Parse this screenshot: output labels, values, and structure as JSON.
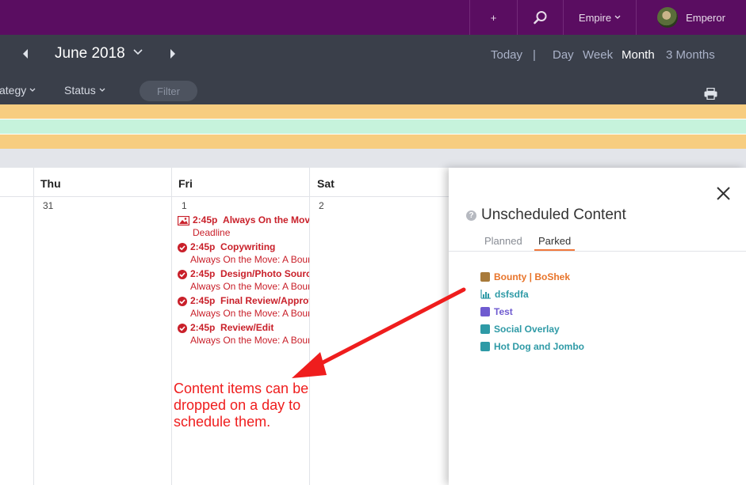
{
  "topbar": {
    "add_icon": "plus-icon",
    "search_icon": "search-icon",
    "workspace_label": "Empire",
    "user_name": "Emperor"
  },
  "nav": {
    "month_title": "June 2018",
    "today": "Today",
    "separator": "|",
    "views": [
      "Day",
      "Week",
      "Month",
      "3 Months"
    ],
    "active_view": "Month"
  },
  "filters": {
    "category_label": "ategy",
    "status_label": "Status",
    "filter_button": "Filter"
  },
  "calendar": {
    "headers": [
      "Thu",
      "Fri",
      "Sat"
    ],
    "day_numbers": [
      "31",
      "1",
      "2"
    ],
    "events": [
      {
        "time": "2:45p",
        "title": "Always On the Move",
        "sub": "Deadline",
        "icon": "image-icon"
      },
      {
        "time": "2:45p",
        "title": "Copywriting",
        "sub": "Always On the Move: A Bour",
        "icon": "check-circle-icon"
      },
      {
        "time": "2:45p",
        "title": "Design/Photo Sourci",
        "sub": "Always On the Move: A Bour",
        "icon": "check-circle-icon"
      },
      {
        "time": "2:45p",
        "title": "Final Review/Approv",
        "sub": "Always On the Move: A Bour",
        "icon": "check-circle-icon"
      },
      {
        "time": "2:45p",
        "title": "Review/Edit",
        "sub": "Always On the Move: A Bour",
        "icon": "check-circle-icon"
      }
    ],
    "annotation": "Content items can be dropped on a day to schedule them."
  },
  "panel": {
    "title": "Unscheduled Content",
    "tabs": [
      "Planned",
      "Parked"
    ],
    "active_tab": "Parked",
    "items": [
      {
        "label": "Bounty | BoShek",
        "color": "#e8742a",
        "icon": "bounty-icon"
      },
      {
        "label": "dsfsdfa",
        "color": "#2e9aa6",
        "icon": "chart-icon"
      },
      {
        "label": "Test",
        "color": "#6f5bd0",
        "icon": "twitter-icon"
      },
      {
        "label": "Social Overlay",
        "color": "#2e9aa6",
        "icon": "twitter-icon"
      },
      {
        "label": "Hot Dog and Jombo",
        "color": "#2e9aa6",
        "icon": "rss-icon"
      }
    ]
  },
  "colors": {
    "topbar": "#5a0d61",
    "navbar": "#3a3f4a",
    "accent": "#f2783b",
    "event_red": "#c9202a",
    "annotation_red": "#ef1d1d"
  }
}
